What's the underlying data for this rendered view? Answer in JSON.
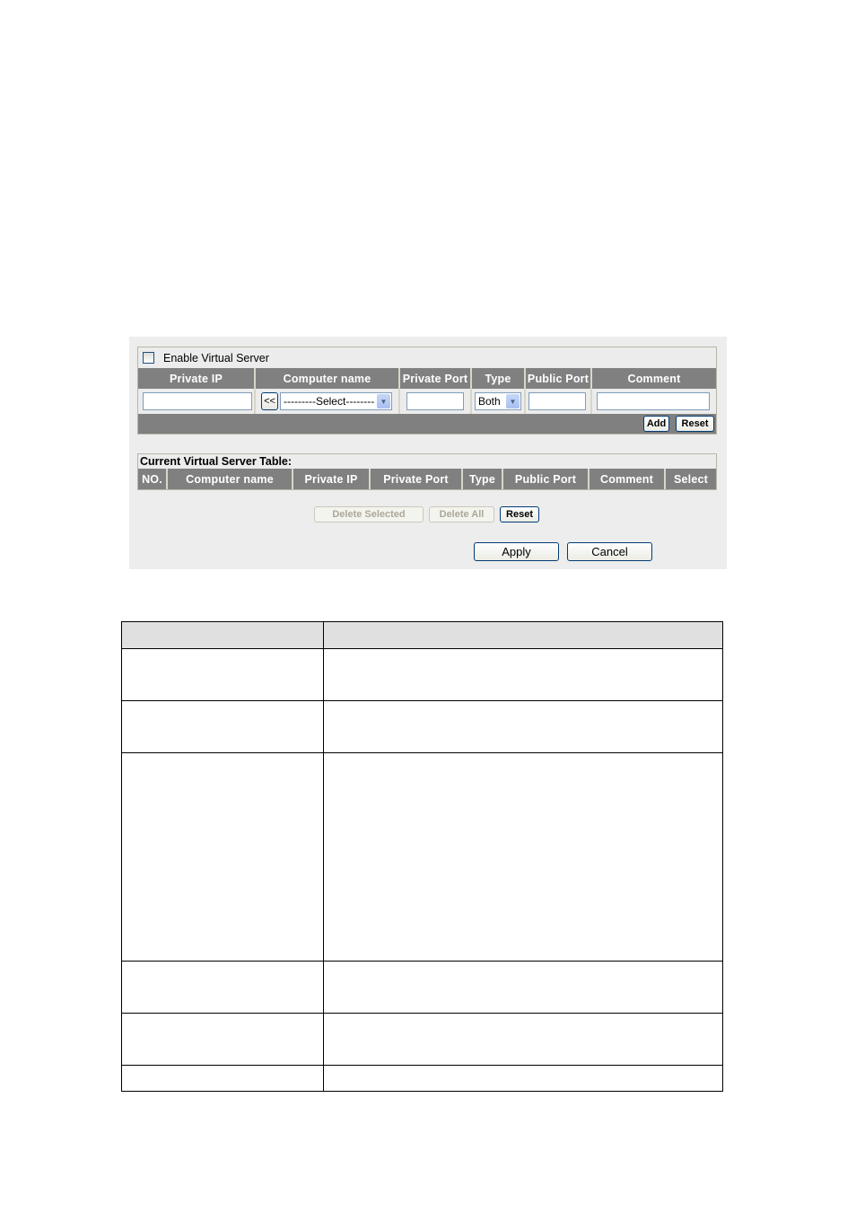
{
  "virtual_server_form": {
    "enable_label": "Enable Virtual Server",
    "enabled": false,
    "columns": [
      "Private IP",
      "Computer name",
      "Private Port",
      "Type",
      "Public Port",
      "Comment"
    ],
    "inputs": {
      "private_ip": "",
      "computer_name_back_label": "<<",
      "computer_name_select": "---------Select--------",
      "private_port": "",
      "type_select": "Both",
      "public_port": "",
      "comment": ""
    },
    "add_label": "Add",
    "reset_label": "Reset"
  },
  "current_table": {
    "title": "Current Virtual Server Table:",
    "columns": [
      "NO.",
      "Computer name",
      "Private IP",
      "Private Port",
      "Type",
      "Public Port",
      "Comment",
      "Select"
    ],
    "rows": []
  },
  "table_actions": {
    "delete_selected_label": "Delete Selected",
    "delete_all_label": "Delete All",
    "reset_label": "Reset"
  },
  "footer": {
    "apply_label": "Apply",
    "cancel_label": "Cancel"
  },
  "description_table": {
    "header": [
      "",
      ""
    ],
    "rows": [
      [
        "",
        ""
      ],
      [
        "",
        ""
      ],
      [
        "",
        ""
      ],
      [
        "",
        ""
      ],
      [
        "",
        ""
      ],
      [
        "",
        ""
      ]
    ]
  }
}
